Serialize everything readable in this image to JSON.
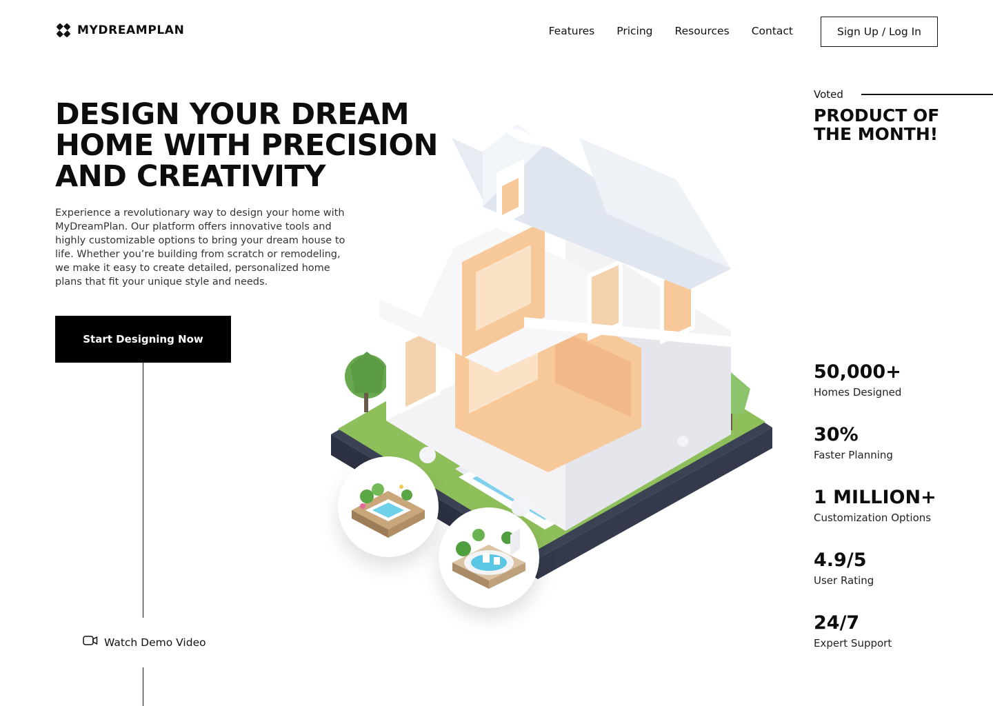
{
  "brand": {
    "name": "MYDREAMPLAN"
  },
  "nav": {
    "items": [
      {
        "label": "Features"
      },
      {
        "label": "Pricing"
      },
      {
        "label": "Resources"
      },
      {
        "label": "Contact"
      }
    ],
    "auth_label": "Sign Up / Log In"
  },
  "hero": {
    "title": "DESIGN YOUR DREAM HOME WITH PRECISION AND CREATIVITY",
    "description": "Experience a revolutionary way to design your home with MyDreamPlan. Our platform offers innovative tools and highly customizable options to bring your dream house to life. Whether you’re building from scratch or remodeling, we make it easy to create detailed, personalized home plans that fit your unique style and needs.",
    "cta_label": "Start Designing Now",
    "demo_label": "Watch Demo Video"
  },
  "award": {
    "voted": "Voted",
    "title": "PRODUCT OF THE MONTH!"
  },
  "stats": [
    {
      "value": "50,000+",
      "label": "Homes Designed"
    },
    {
      "value": "30%",
      "label": "Faster Planning"
    },
    {
      "value": "1 MILLION+",
      "label": "Customization Options"
    },
    {
      "value": "4.9/5",
      "label": "User Rating"
    },
    {
      "value": "24/7",
      "label": "Expert Support"
    }
  ],
  "icons": {
    "logo": "logo-icon",
    "video": "video-camera-icon"
  },
  "colors": {
    "primary": "#000000",
    "background": "#ffffff",
    "lawn": "#8fbf5a",
    "pool": "#7ed0ec",
    "window_glow": "#f6c89a"
  }
}
